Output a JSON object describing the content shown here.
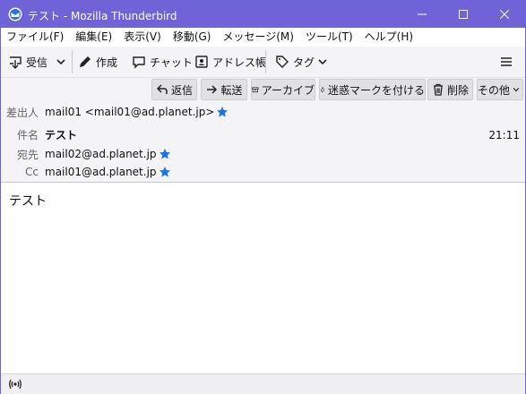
{
  "window": {
    "title": "テスト - Mozilla Thunderbird"
  },
  "menubar": [
    "ファイル(F)",
    "編集(E)",
    "表示(V)",
    "移動(G)",
    "メッセージ(M)",
    "ツール(T)",
    "ヘルプ(H)"
  ],
  "toolbar": {
    "get_mail": "受信",
    "compose": "作成",
    "chat": "チャット",
    "address_book": "アドレス帳",
    "tag": "タグ"
  },
  "header_buttons": {
    "reply": "返信",
    "forward": "転送",
    "archive": "アーカイブ",
    "junk": "迷惑マークを付ける",
    "delete": "削除",
    "other": "その他"
  },
  "message": {
    "from_label": "差出人",
    "from_value": "mail01 <mail01@ad.planet.jp>",
    "subject_label": "件名",
    "subject_value": "テスト",
    "time": "21:11",
    "to_label": "宛先",
    "to_value": "mail02@ad.planet.jp",
    "cc_label": "Cc",
    "cc_value": "mail01@ad.planet.jp",
    "body": "テスト"
  },
  "colors": {
    "titlebar": "#6f63d8",
    "star": "#1a73e8",
    "panel": "#f4f4f6"
  }
}
